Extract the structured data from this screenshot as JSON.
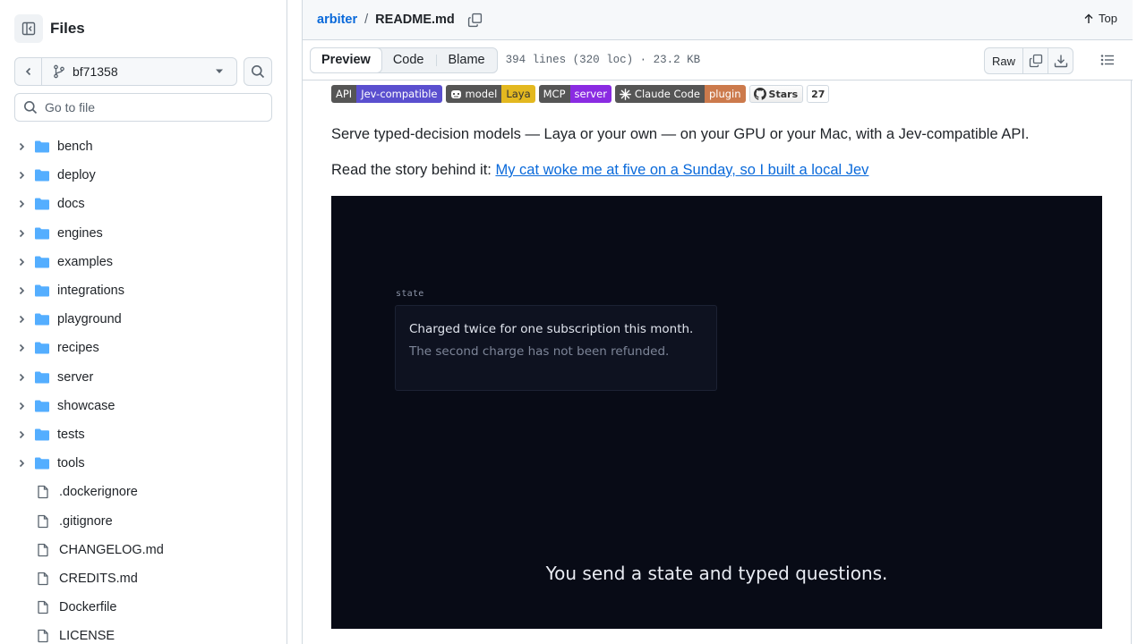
{
  "sidebar": {
    "title": "Files",
    "branch": "bf71358",
    "search_placeholder": "Go to file",
    "items": [
      {
        "type": "dir",
        "label": "bench"
      },
      {
        "type": "dir",
        "label": "deploy"
      },
      {
        "type": "dir",
        "label": "docs"
      },
      {
        "type": "dir",
        "label": "engines"
      },
      {
        "type": "dir",
        "label": "examples"
      },
      {
        "type": "dir",
        "label": "integrations"
      },
      {
        "type": "dir",
        "label": "playground"
      },
      {
        "type": "dir",
        "label": "recipes"
      },
      {
        "type": "dir",
        "label": "server"
      },
      {
        "type": "dir",
        "label": "showcase"
      },
      {
        "type": "dir",
        "label": "tests"
      },
      {
        "type": "dir",
        "label": "tools"
      },
      {
        "type": "file",
        "label": ".dockerignore"
      },
      {
        "type": "file",
        "label": ".gitignore"
      },
      {
        "type": "file",
        "label": "CHANGELOG.md"
      },
      {
        "type": "file",
        "label": "CREDITS.md"
      },
      {
        "type": "file",
        "label": "Dockerfile"
      },
      {
        "type": "file",
        "label": "LICENSE"
      }
    ]
  },
  "header": {
    "repo": "arbiter",
    "separator": "/",
    "file": "README.md",
    "top_label": "Top"
  },
  "toolbar": {
    "tabs": [
      "Preview",
      "Code",
      "Blame"
    ],
    "active_tab": "Preview",
    "meta": "394 lines (320 loc) · 23.2 KB",
    "raw_label": "Raw"
  },
  "readme": {
    "badges": [
      {
        "left": "API",
        "right": "Jev-compatible",
        "color": "#5a4fcf"
      },
      {
        "left": "model",
        "right": "Laya",
        "color": "#e3b81f",
        "icon": "robot-icon"
      },
      {
        "left": "MCP",
        "right": "server",
        "color": "#8a2be2"
      },
      {
        "left": "Claude Code",
        "right": "plugin",
        "color": "#cc7a4c",
        "icon": "sparkle-icon"
      }
    ],
    "stars_label": "Stars",
    "stars_count": "27",
    "intro": "Serve typed-decision models — Laya or your own — on your GPU or your Mac, with a Jev-compatible API.",
    "story_prefix": "Read the story behind it: ",
    "story_link": "My cat woke me at five on a Sunday, so I built a local Jev",
    "demo": {
      "state_label": "state",
      "line1": "Charged twice for one subscription this month.",
      "line2": "The second charge has not been refunded.",
      "caption": "You send a state and typed questions."
    }
  },
  "colors": {
    "link": "#0969da",
    "folder": "#54aeff",
    "border": "#d1d9e0"
  }
}
